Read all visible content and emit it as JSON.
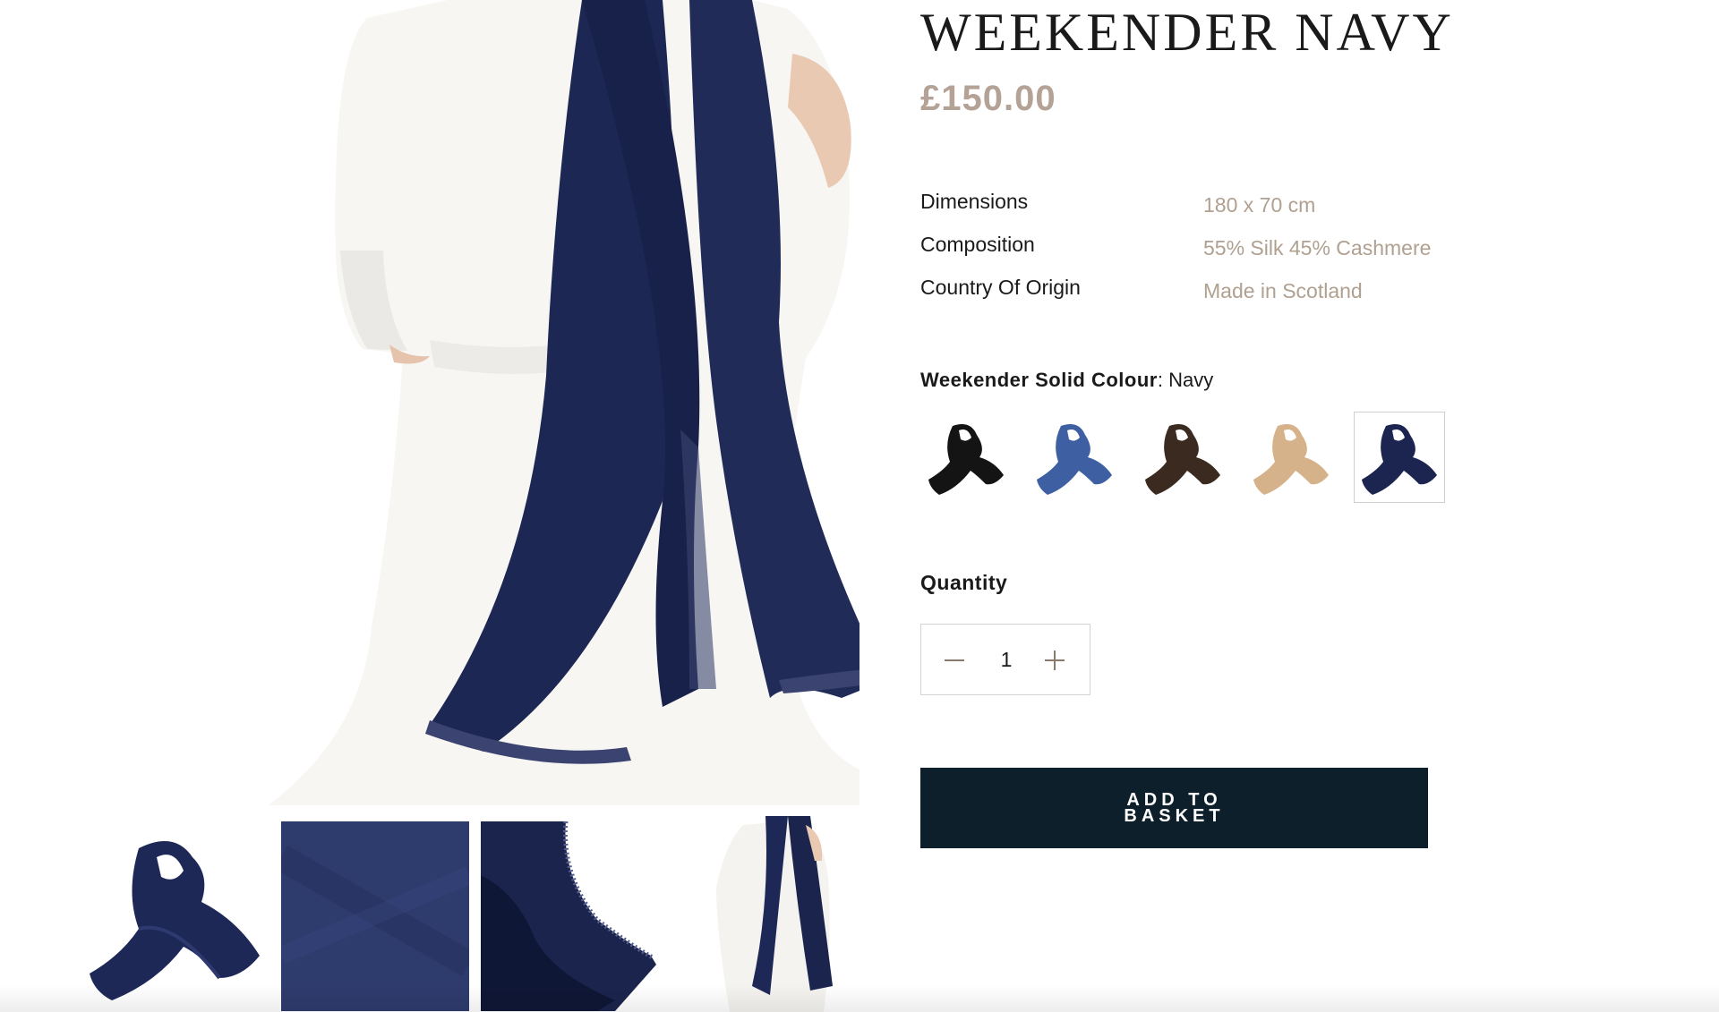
{
  "product": {
    "title": "WEEKENDER NAVY",
    "price": "£150.00"
  },
  "specs": [
    {
      "label": "Dimensions",
      "value": "180 x 70 cm"
    },
    {
      "label": "Composition",
      "value": "55% Silk 45% Cashmere"
    },
    {
      "label": "Country Of Origin",
      "value": "Made in Scotland"
    }
  ],
  "colour": {
    "heading": "Weekender Solid Colour",
    "separator": ":",
    "selected": "Navy",
    "swatches": [
      {
        "icon": "scarf-black-swatch",
        "color": "#141414"
      },
      {
        "icon": "scarf-blue-swatch",
        "color": "#3f5fa3"
      },
      {
        "icon": "scarf-brown-swatch",
        "color": "#3a2a20"
      },
      {
        "icon": "scarf-camel-swatch",
        "color": "#d6b28a"
      },
      {
        "icon": "scarf-navy-swatch",
        "color": "#1b2550",
        "selected": true
      }
    ]
  },
  "quantity": {
    "label": "Quantity",
    "value": "1",
    "decrement_icon": "minus-icon",
    "increment_icon": "plus-icon"
  },
  "cta": {
    "add_to_basket": "ADD TO BASKET"
  },
  "theme": {
    "accent_price": "#b3a295",
    "button_bg": "#0c1f2a",
    "scarf_navy": "#1f2a55"
  },
  "gallery": {
    "thumbnails": [
      "folded-scarf",
      "fabric-closeup",
      "fringe-detail",
      "model-wearing-scarf"
    ]
  }
}
